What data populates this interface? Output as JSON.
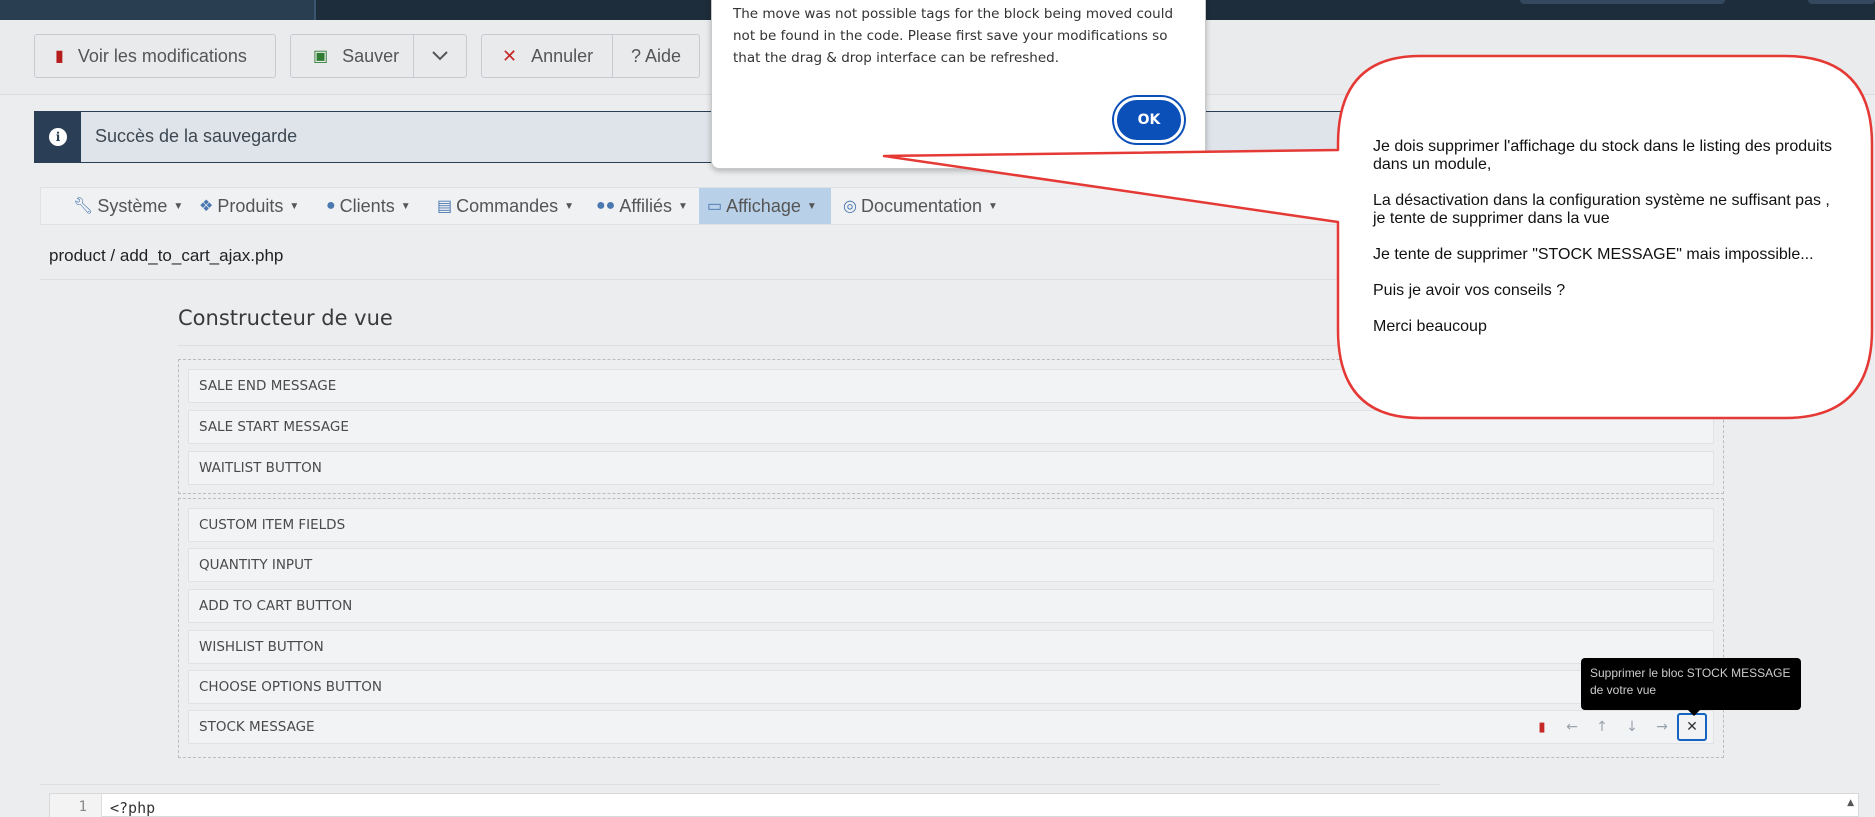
{
  "toolbar": {
    "voir_label": "Voir les modifications",
    "sauver_label": "Sauver",
    "annuler_label": "Annuler",
    "aide_label": "? Aide"
  },
  "banner": {
    "text": "Succès de la sauvegarde"
  },
  "menu": {
    "items": [
      {
        "label": "Système",
        "icon": "wrench-icon"
      },
      {
        "label": "Produits",
        "icon": "cubes-icon"
      },
      {
        "label": "Clients",
        "icon": "user-icon"
      },
      {
        "label": "Commandes",
        "icon": "credit-card-icon"
      },
      {
        "label": "Affiliés",
        "icon": "users-icon"
      },
      {
        "label": "Affichage",
        "icon": "desktop-icon",
        "active": true
      },
      {
        "label": "Documentation",
        "icon": "life-ring-icon"
      }
    ]
  },
  "file": {
    "path": "product / add_to_cart_ajax.php"
  },
  "builder": {
    "title": "Constructeur de vue",
    "group1": [
      "SALE END MESSAGE",
      "SALE START MESSAGE",
      "WAITLIST BUTTON"
    ],
    "group2": [
      "CUSTOM ITEM FIELDS",
      "QUANTITY INPUT",
      "ADD TO CART BUTTON",
      "WISHLIST BUTTON",
      "CHOOSE OPTIONS BUTTON",
      "STOCK MESSAGE"
    ]
  },
  "tooltip": {
    "text": "Supprimer le bloc STOCK MESSAGE de votre vue"
  },
  "code": {
    "line_number": "1",
    "line": "<?php"
  },
  "dialog": {
    "message": "The move was not possible tags for the block being moved could not be found in the code. Please first save your modifications so that the drag & drop interface can be refreshed.",
    "ok_label": "OK"
  },
  "bubble": {
    "lines": [
      "Je dois supprimer l'affichage du stock dans le listing des produits dans un module,",
      "La désactivation dans la configuration système ne suffisant pas , je tente de supprimer dans la vue",
      "Je tente de supprimer \"STOCK MESSAGE\" mais impossible...",
      "Puis je avoir vos conseils ?",
      "Merci beaucoup"
    ]
  },
  "colors": {
    "accent": "#0b4fb8",
    "bubble_border": "#e53935",
    "dark_header": "#1e2d3b"
  }
}
